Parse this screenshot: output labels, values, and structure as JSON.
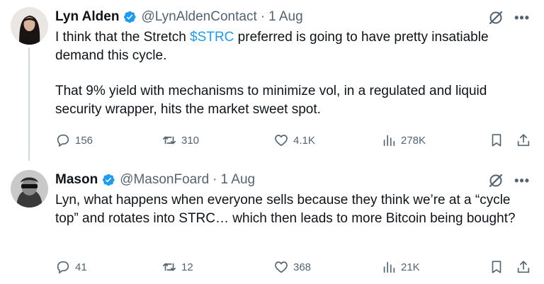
{
  "tweets": [
    {
      "author": {
        "name": "Lyn Alden",
        "handle": "@LynAldenContact",
        "separator": "·",
        "date": "1 Aug"
      },
      "text_parts": {
        "p1_before": "I think that the Stretch ",
        "p1_cashtag": "$STRC",
        "p1_after": " preferred is going to have pretty insatiable demand this cycle.",
        "p2": "That 9% yield with mechanisms to minimize vol, in a regulated and liquid security wrapper, hits the market sweet spot."
      },
      "metrics": {
        "replies": "156",
        "retweets": "310",
        "likes": "4.1K",
        "views": "278K"
      }
    },
    {
      "author": {
        "name": "Mason",
        "handle": "@MasonFoard",
        "separator": "·",
        "date": "1 Aug"
      },
      "text": "Lyn, what happens when everyone sells because they think we’re at a “cycle top” and rotates into STRC… which then leads to more Bitcoin being bought?",
      "metrics": {
        "replies": "41",
        "retweets": "12",
        "likes": "368",
        "views": "21K"
      }
    }
  ],
  "icons": {
    "verified": "verified-badge-icon",
    "grok": "grok-icon",
    "more": "more-icon",
    "reply": "reply-icon",
    "retweet": "retweet-icon",
    "like": "like-icon",
    "views": "views-icon",
    "bookmark": "bookmark-icon",
    "share": "share-icon"
  },
  "colors": {
    "text": "#0f1419",
    "secondary": "#536471",
    "accent": "#1d9bf0",
    "thread_line": "#cfd9de"
  }
}
